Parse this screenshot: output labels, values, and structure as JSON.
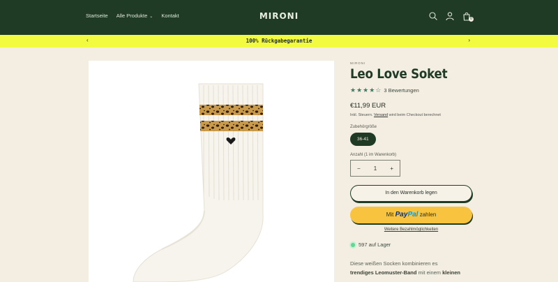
{
  "header": {
    "nav": [
      {
        "label": "Startseite"
      },
      {
        "label": "Alle Produkte"
      },
      {
        "label": "Kontakt"
      }
    ],
    "logo": "MIRONI",
    "cart_count": "0",
    "icons": [
      "search-icon",
      "account-icon",
      "cart-icon"
    ]
  },
  "announcement": {
    "text": "100% Rückgabegarantie"
  },
  "product": {
    "vendor": "MIRONI",
    "title": "Leo Love Soket",
    "rating_value": 4.5,
    "rating_text": "3 Bewertungen",
    "price": "€11,99 EUR",
    "tax_prefix": "Inkl. Steuern.",
    "tax_link": "Versand",
    "tax_suffix": "wird beim Checkout berechnet",
    "size_label": "Zubehörgröße",
    "size_value": "36-41",
    "qty_label": "Anzahl (1 im Warenkorb)",
    "qty_value": "1",
    "add_to_cart": "In den Warenkorb legen",
    "paypal_prefix": "Mit",
    "paypal_pay": "Pay",
    "paypal_pal": "Pal",
    "paypal_suffix": "zahlen",
    "more_payment": "Weitere Bezahlmöglichkeiten",
    "stock": "597 auf Lager",
    "desc_line1": "Diese weißen Socken kombinieren es",
    "desc_bold1": "trendiges Leomuster-Band",
    "desc_mid": "mit einem",
    "desc_bold2": "kleinen"
  },
  "colors": {
    "header_bg": "#1f3b26",
    "announce_bg": "#f2fb3f",
    "page_bg": "#f3ede2",
    "paypal_btn": "#f8c440",
    "star": "#3c7a63"
  }
}
